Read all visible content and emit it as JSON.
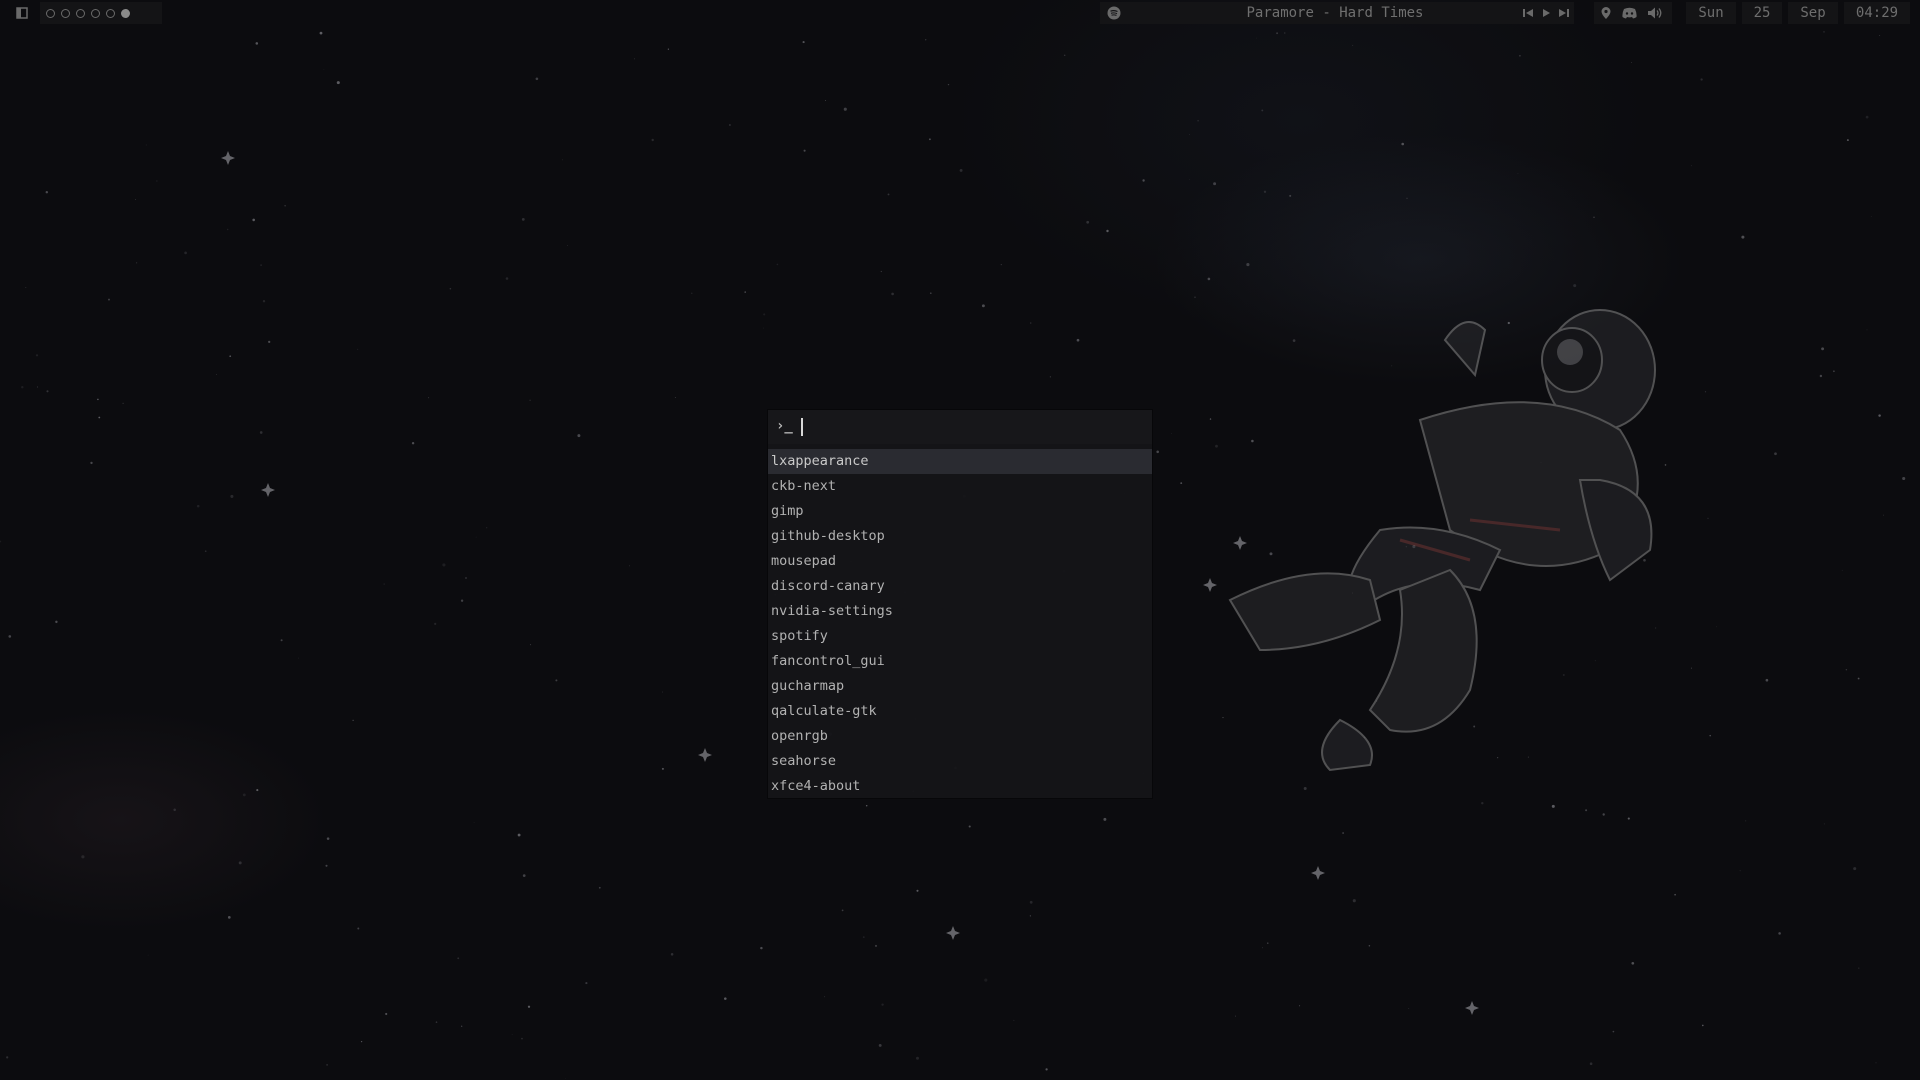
{
  "topbar": {
    "workspaces": [
      {
        "active": false
      },
      {
        "active": false
      },
      {
        "active": false
      },
      {
        "active": false
      },
      {
        "active": false
      },
      {
        "active": true
      }
    ],
    "now_playing": "Paramore - Hard Times",
    "media_controls": [
      "previous-icon",
      "play-icon",
      "next-icon"
    ],
    "status_icons": [
      "location-pin-icon",
      "discord-icon",
      "volume-icon"
    ],
    "day": "Sun",
    "date": "25",
    "month": "Sep",
    "time": "04:29"
  },
  "launcher": {
    "prompt_symbol": "›_",
    "query": "",
    "results": [
      "lxappearance",
      "ckb-next",
      "gimp",
      "github-desktop",
      "mousepad",
      "discord-canary",
      "nvidia-settings",
      "spotify",
      "fancontrol_gui",
      "gucharmap",
      "qalculate-gtk",
      "openrgb",
      "seahorse",
      "xfce4-about"
    ],
    "selected_index": 0
  },
  "colors": {
    "background": "#0c0c0f",
    "bar_block": "#141416",
    "launcher_bg": "#151518",
    "selected_row": "#2a2b31",
    "text": "#b2b2b2"
  }
}
